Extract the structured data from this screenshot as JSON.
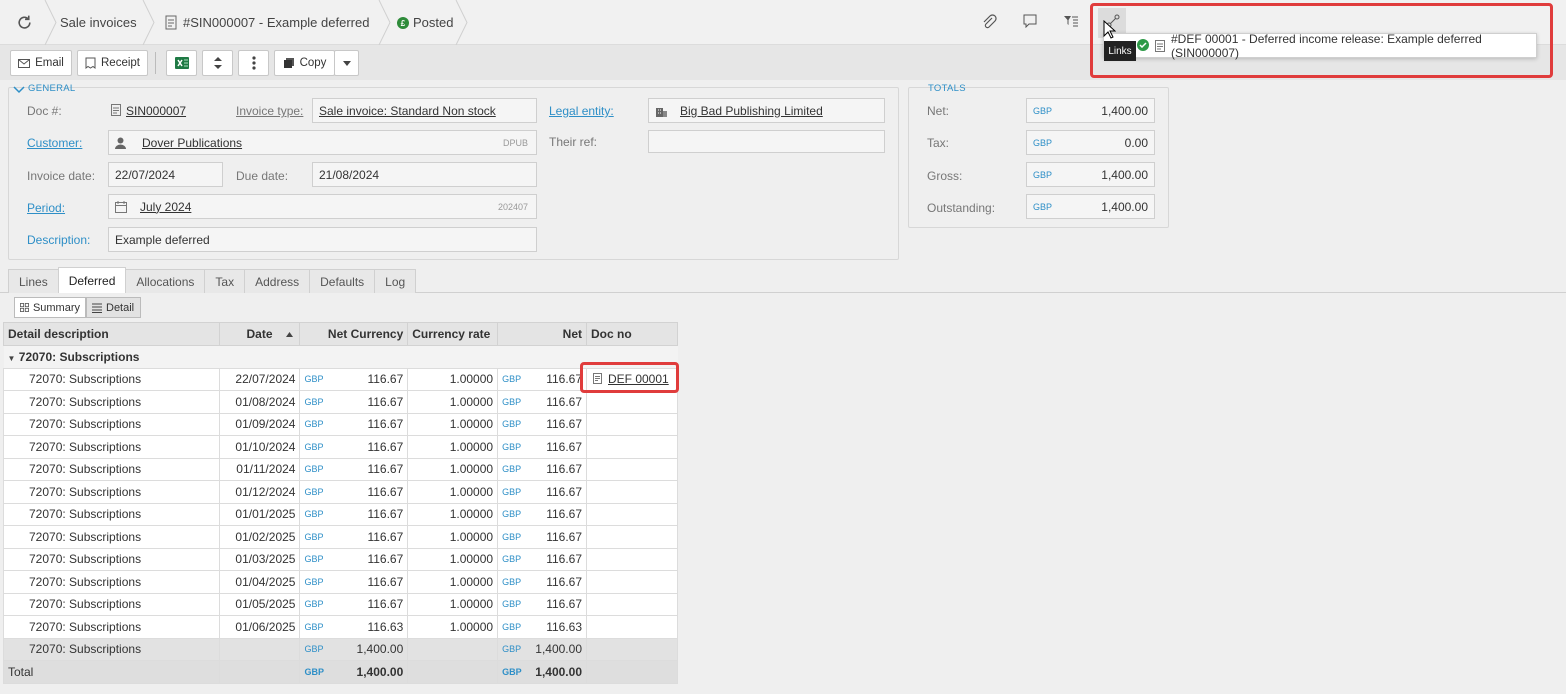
{
  "breadcrumb": {
    "module": "Sale invoices",
    "document": "#SIN000007 - Example deferred",
    "status": "Posted"
  },
  "toolbar": {
    "email_label": "Email",
    "receipt_label": "Receipt",
    "copy_label": "Copy"
  },
  "links_popup": {
    "tooltip": "Links",
    "item": "#DEF 00001 - Deferred income release: Example deferred (SIN000007)"
  },
  "general": {
    "section": "GENERAL",
    "doc_no_label": "Doc #:",
    "doc_no": "SIN000007",
    "invoice_type_label": "Invoice type:",
    "invoice_type": "Sale invoice: Standard Non stock",
    "legal_entity_label": "Legal entity:",
    "legal_entity": "Big Bad Publishing Limited",
    "customer_label": "Customer:",
    "customer": "Dover Publications",
    "customer_code": "DPUB",
    "their_ref_label": "Their ref:",
    "their_ref": "",
    "invoice_date_label": "Invoice date:",
    "invoice_date": "22/07/2024",
    "due_date_label": "Due date:",
    "due_date": "21/08/2024",
    "period_label": "Period:",
    "period": "July 2024",
    "period_code": "202407",
    "description_label": "Description:",
    "description": "Example deferred"
  },
  "totals": {
    "section": "TOTALS",
    "net_label": "Net:",
    "net": "1,400.00",
    "tax_label": "Tax:",
    "tax": "0.00",
    "gross_label": "Gross:",
    "gross": "1,400.00",
    "outstanding_label": "Outstanding:",
    "outstanding": "1,400.00",
    "currency": "GBP"
  },
  "tabs": [
    "Lines",
    "Deferred",
    "Allocations",
    "Tax",
    "Address",
    "Defaults",
    "Log"
  ],
  "view_buttons": {
    "summary": "Summary",
    "detail": "Detail"
  },
  "grid": {
    "columns": [
      "Detail description",
      "Date",
      "Net Currency",
      "Currency rate",
      "Net",
      "Doc no"
    ],
    "group": "72070: Subscriptions",
    "currency": "GBP",
    "rows": [
      {
        "desc": "72070: Subscriptions",
        "date": "22/07/2024",
        "net_cur": "116.67",
        "rate": "1.00000",
        "net": "116.67",
        "doc": "DEF 00001"
      },
      {
        "desc": "72070: Subscriptions",
        "date": "01/08/2024",
        "net_cur": "116.67",
        "rate": "1.00000",
        "net": "116.67",
        "doc": ""
      },
      {
        "desc": "72070: Subscriptions",
        "date": "01/09/2024",
        "net_cur": "116.67",
        "rate": "1.00000",
        "net": "116.67",
        "doc": ""
      },
      {
        "desc": "72070: Subscriptions",
        "date": "01/10/2024",
        "net_cur": "116.67",
        "rate": "1.00000",
        "net": "116.67",
        "doc": ""
      },
      {
        "desc": "72070: Subscriptions",
        "date": "01/11/2024",
        "net_cur": "116.67",
        "rate": "1.00000",
        "net": "116.67",
        "doc": ""
      },
      {
        "desc": "72070: Subscriptions",
        "date": "01/12/2024",
        "net_cur": "116.67",
        "rate": "1.00000",
        "net": "116.67",
        "doc": ""
      },
      {
        "desc": "72070: Subscriptions",
        "date": "01/01/2025",
        "net_cur": "116.67",
        "rate": "1.00000",
        "net": "116.67",
        "doc": ""
      },
      {
        "desc": "72070: Subscriptions",
        "date": "01/02/2025",
        "net_cur": "116.67",
        "rate": "1.00000",
        "net": "116.67",
        "doc": ""
      },
      {
        "desc": "72070: Subscriptions",
        "date": "01/03/2025",
        "net_cur": "116.67",
        "rate": "1.00000",
        "net": "116.67",
        "doc": ""
      },
      {
        "desc": "72070: Subscriptions",
        "date": "01/04/2025",
        "net_cur": "116.67",
        "rate": "1.00000",
        "net": "116.67",
        "doc": ""
      },
      {
        "desc": "72070: Subscriptions",
        "date": "01/05/2025",
        "net_cur": "116.67",
        "rate": "1.00000",
        "net": "116.67",
        "doc": ""
      },
      {
        "desc": "72070: Subscriptions",
        "date": "01/06/2025",
        "net_cur": "116.63",
        "rate": "1.00000",
        "net": "116.63",
        "doc": ""
      }
    ],
    "subtotal": {
      "desc": "72070: Subscriptions",
      "net_cur": "1,400.00",
      "net": "1,400.00"
    },
    "total": {
      "desc": "Total",
      "net_cur": "1,400.00",
      "net": "1,400.00"
    }
  }
}
